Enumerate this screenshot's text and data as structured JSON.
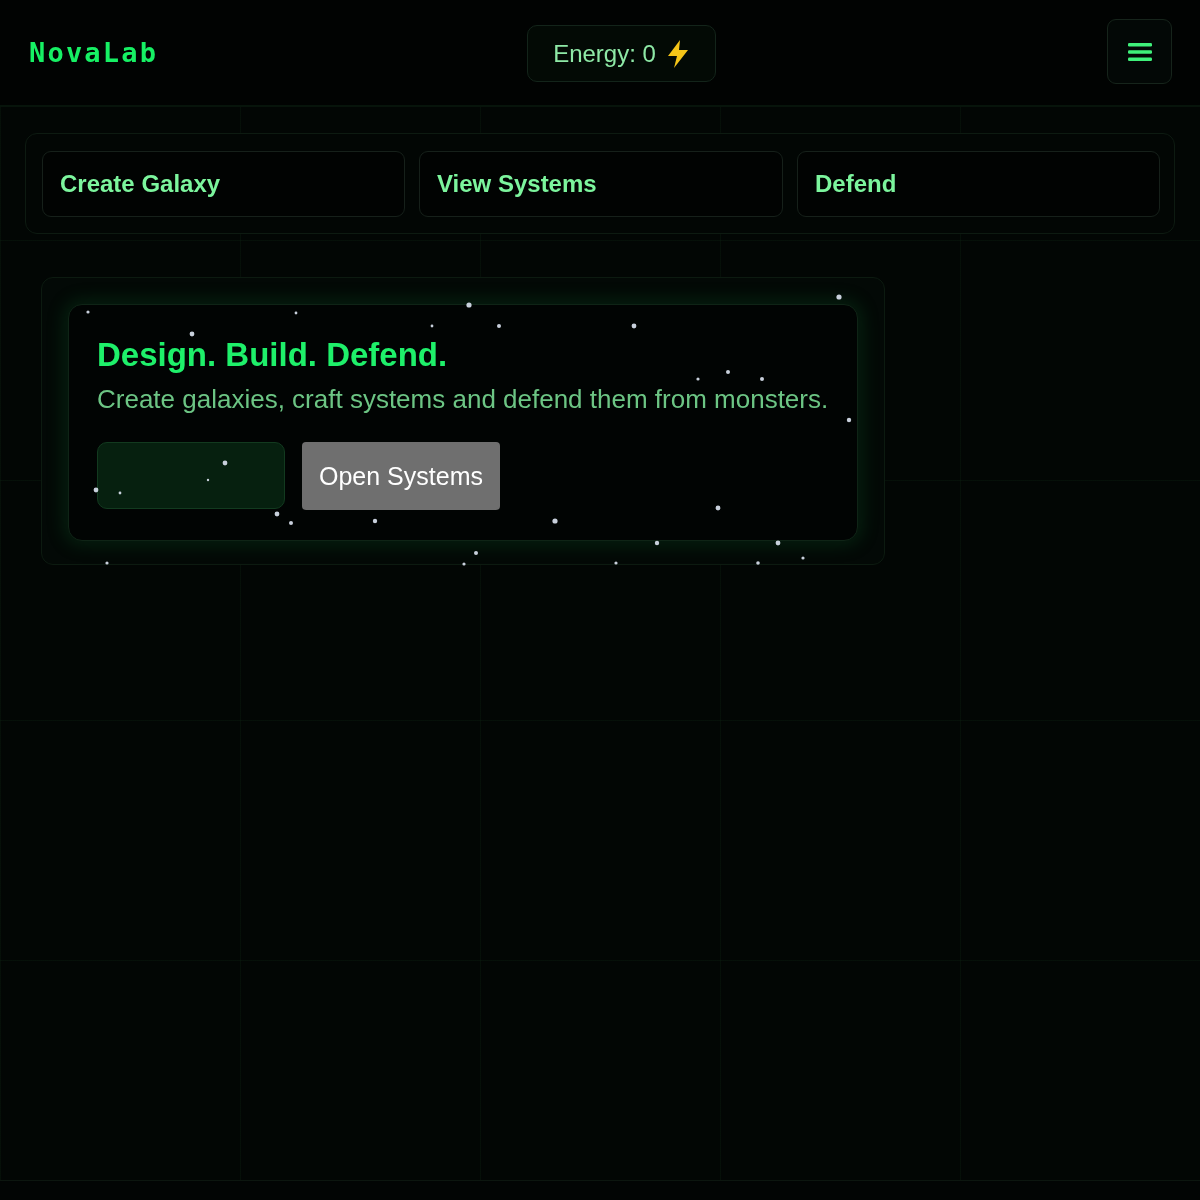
{
  "header": {
    "logo": "NovaLab",
    "energy": "Energy: 0"
  },
  "nav": [
    {
      "label": "Create Galaxy"
    },
    {
      "label": "View Systems"
    },
    {
      "label": "Defend"
    }
  ],
  "hero": {
    "title": "Design. Build. Defend.",
    "subtitle": "Create galaxies, craft systems and defend them from monsters.",
    "buttons": [
      {
        "kind": "blank"
      },
      {
        "kind": "secondary",
        "label": "Open Systems"
      }
    ]
  }
}
